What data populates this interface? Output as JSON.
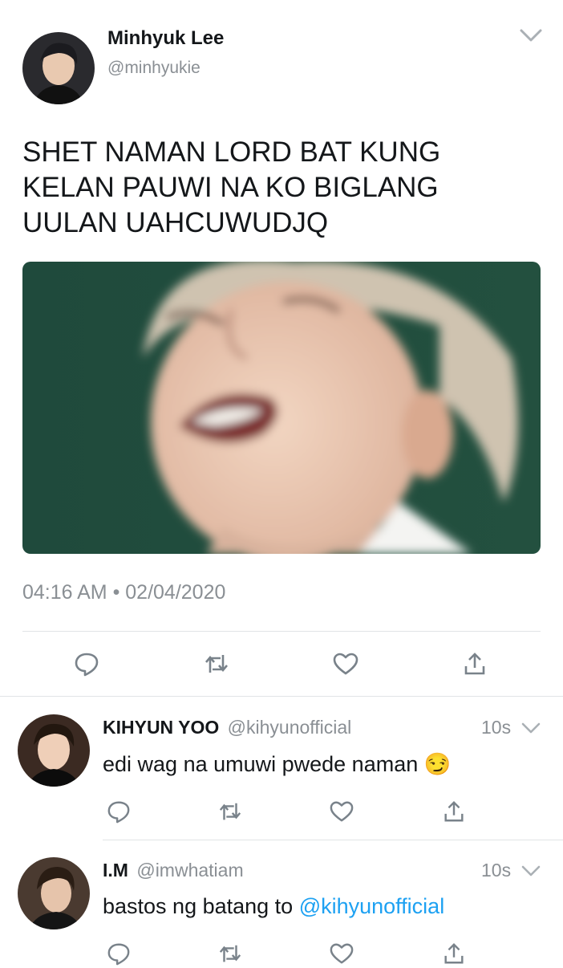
{
  "main_tweet": {
    "author_name": "Minhyuk Lee",
    "author_handle": "@minhyukie",
    "text_lines": [
      "SHET NAMAN LORD BAT KUNG",
      "KELAN PAUWI NA KO BIGLANG",
      "UULAN UAHCUWUDJQ"
    ],
    "timestamp": "04:16 AM • 02/04/2020",
    "media_description_icon": "crying-face-photo"
  },
  "replies": [
    {
      "name": "KIHYUN YOO",
      "handle": "@kihyunofficial",
      "time": "10s",
      "text": "edi wag na umuwi pwede naman ",
      "emoji": "😏"
    },
    {
      "name": "I.M",
      "handle": "@imwhatiam",
      "time": "10s",
      "text": "bastos ng batang to ",
      "mention": "@kihyunofficial"
    }
  ],
  "icons": [
    "reply-icon",
    "retweet-icon",
    "like-icon",
    "share-icon",
    "chevron-down-icon"
  ],
  "colors": {
    "text": "#14171a",
    "secondary": "#8a8f94",
    "link": "#1da1f2",
    "divider": "#e1e4e6"
  }
}
